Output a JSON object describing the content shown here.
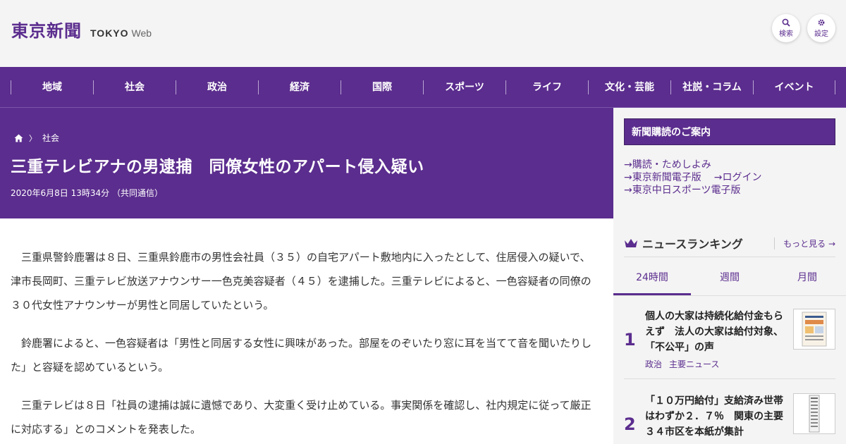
{
  "header": {
    "logo_main": "東京新聞",
    "logo_tokyo": "TOKYO",
    "logo_web": "Web",
    "search_label": "検索",
    "settings_label": "設定"
  },
  "nav": {
    "items": [
      "地域",
      "社会",
      "政治",
      "経済",
      "国際",
      "スポーツ",
      "ライフ",
      "文化・芸能",
      "社説・コラム",
      "イベント"
    ]
  },
  "article": {
    "breadcrumb_category": "社会",
    "title": "三重テレビアナの男逮捕　同僚女性のアパート侵入疑い",
    "dateline": "2020年6月8日 13時34分 （共同通信）",
    "paragraphs": [
      "三重県警鈴鹿署は８日、三重県鈴鹿市の男性会社員（３５）の自宅アパート敷地内に入ったとして、住居侵入の疑いで、津市長岡町、三重テレビ放送アナウンサー一色克美容疑者（４５）を逮捕した。三重テレビによると、一色容疑者の同僚の３０代女性アナウンサーが男性と同居していたという。",
      "鈴鹿署によると、一色容疑者は「男性と同居する女性に興味があった。部屋をのぞいたり窓に耳を当てて音を聞いたりした」と容疑を認めているという。",
      "三重テレビは８日「社員の逮捕は誠に遺憾であり、大変重く受け止めている。事実関係を確認し、社内規定に従って厳正に対応する」とのコメントを発表した。"
    ]
  },
  "sidebar": {
    "subscription_title": "新聞購読のご案内",
    "links": [
      "購読・ためしよみ",
      "東京新聞電子版",
      "ログイン",
      "東京中日スポーツ電子版"
    ],
    "ranking": {
      "title": "ニュースランキング",
      "more": "もっと見る",
      "tabs": [
        "24時間",
        "週間",
        "月間"
      ],
      "items": [
        {
          "rank": "1",
          "text": "個人の大家は持続化給付金もらえず　法人の大家は給付対象、「不公平」の声",
          "tags": [
            "政治",
            "主要ニュース"
          ]
        },
        {
          "rank": "2",
          "text": "「１０万円給付」支給済み世帯はわずか２．７％　関東の主要３４市区を本紙が集計",
          "tags": []
        }
      ]
    }
  },
  "colors": {
    "brand": "#5b2d8e",
    "background": "#f4f4f4"
  }
}
